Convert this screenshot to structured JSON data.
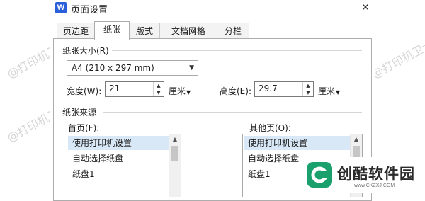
{
  "window": {
    "app_icon_letter": "W",
    "title": "页面设置",
    "close_glyph": "✕"
  },
  "tabs": [
    {
      "label": "页边距"
    },
    {
      "label": "纸张"
    },
    {
      "label": "版式"
    },
    {
      "label": "文档网格"
    },
    {
      "label": "分栏"
    }
  ],
  "active_tab": "纸张",
  "paper_size": {
    "section_label": "纸张大小(R)",
    "selected": "A4 (210 x 297 mm)",
    "width_label": "宽度(W):",
    "width_value": "21",
    "width_unit": "厘米",
    "height_label": "高度(E):",
    "height_value": "29.7",
    "height_unit": "厘米"
  },
  "paper_source": {
    "section_label": "纸张来源",
    "first_page_label": "首页(F):",
    "other_pages_label": "其他页(O):",
    "first_page_items": [
      "使用打印机设置",
      "自动选择纸盘",
      "纸盘1"
    ],
    "other_pages_items": [
      "使用打印机设置",
      "自动选择纸盘",
      "纸盘1"
    ]
  },
  "watermark_text": "@打印机卫士",
  "brand": {
    "name": "创酷软件园",
    "url": "www.CKZXJ.COM"
  },
  "colors": {
    "accent": "#2b5fd9",
    "selection": "#d9e8f7",
    "logo_green": "#1aa06d"
  }
}
